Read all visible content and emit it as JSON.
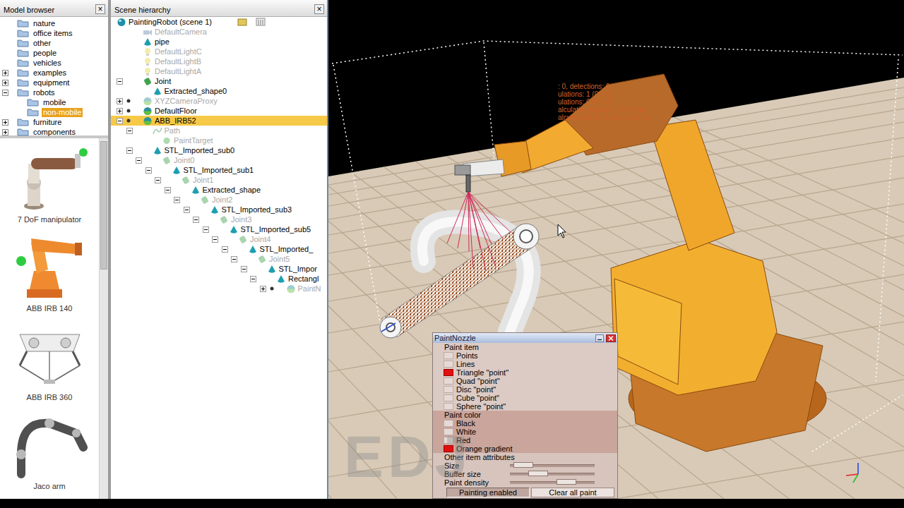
{
  "model_browser": {
    "title": "Model browser",
    "close": "×",
    "folders": [
      {
        "label": "nature",
        "depth": 0,
        "expandable": false,
        "expanded": false,
        "selected": false
      },
      {
        "label": "office items",
        "depth": 0,
        "expandable": false,
        "expanded": false,
        "selected": false
      },
      {
        "label": "other",
        "depth": 0,
        "expandable": false,
        "expanded": false,
        "selected": false
      },
      {
        "label": "people",
        "depth": 0,
        "expandable": false,
        "expanded": false,
        "selected": false
      },
      {
        "label": "vehicles",
        "depth": 0,
        "expandable": false,
        "expanded": false,
        "selected": false
      },
      {
        "label": "examples",
        "depth": 0,
        "expandable": true,
        "expanded": false,
        "selected": false
      },
      {
        "label": "equipment",
        "depth": 0,
        "expandable": true,
        "expanded": false,
        "selected": false
      },
      {
        "label": "robots",
        "depth": 0,
        "expandable": true,
        "expanded": true,
        "selected": false
      },
      {
        "label": "mobile",
        "depth": 1,
        "expandable": false,
        "expanded": false,
        "selected": false
      },
      {
        "label": "non-mobile",
        "depth": 1,
        "expandable": false,
        "expanded": false,
        "selected": true
      },
      {
        "label": "furniture",
        "depth": 0,
        "expandable": true,
        "expanded": false,
        "selected": false
      },
      {
        "label": "components",
        "depth": 0,
        "expandable": true,
        "expanded": false,
        "selected": false
      }
    ],
    "models": [
      {
        "label": "7 DoF manipulator",
        "kind": "manipulator"
      },
      {
        "label": "ABB IRB 140",
        "kind": "irb140"
      },
      {
        "label": "ABB IRB 360",
        "kind": "delta"
      },
      {
        "label": "Jaco arm",
        "kind": "jaco"
      }
    ]
  },
  "scene_hierarchy": {
    "title": "Scene hierarchy",
    "close": "×",
    "items": [
      {
        "label": "PaintingRobot (scene 1)",
        "depth": 0,
        "kind": "scene",
        "disabled": false,
        "expandable": false,
        "expanded": false,
        "model": false,
        "selected": false
      },
      {
        "label": "DefaultCamera",
        "depth": 1,
        "kind": "camera",
        "disabled": true,
        "expandable": false,
        "expanded": false,
        "model": false,
        "selected": false
      },
      {
        "label": "pipe",
        "depth": 1,
        "kind": "shape",
        "disabled": false,
        "expandable": false,
        "expanded": false,
        "model": false,
        "selected": false
      },
      {
        "label": "DefaultLightC",
        "depth": 1,
        "kind": "light",
        "disabled": true,
        "expandable": false,
        "expanded": false,
        "model": false,
        "selected": false
      },
      {
        "label": "DefaultLightB",
        "depth": 1,
        "kind": "light",
        "disabled": true,
        "expandable": false,
        "expanded": false,
        "model": false,
        "selected": false
      },
      {
        "label": "DefaultLightA",
        "depth": 1,
        "kind": "light",
        "disabled": true,
        "expandable": false,
        "expanded": false,
        "model": false,
        "selected": false
      },
      {
        "label": "Joint",
        "depth": 1,
        "kind": "joint",
        "disabled": false,
        "expandable": true,
        "expanded": true,
        "model": false,
        "selected": false
      },
      {
        "label": "Extracted_shape0",
        "depth": 2,
        "kind": "shape",
        "disabled": false,
        "expandable": false,
        "expanded": false,
        "model": false,
        "selected": false
      },
      {
        "label": "XYZCameraProxy",
        "depth": 1,
        "kind": "model",
        "disabled": true,
        "expandable": true,
        "expanded": false,
        "model": true,
        "selected": false
      },
      {
        "label": "DefaultFloor",
        "depth": 1,
        "kind": "model",
        "disabled": false,
        "expandable": true,
        "expanded": false,
        "model": true,
        "selected": false
      },
      {
        "label": "ABB_IRB52",
        "depth": 1,
        "kind": "model",
        "disabled": false,
        "expandable": true,
        "expanded": true,
        "model": true,
        "selected": true
      },
      {
        "label": "Path",
        "depth": 2,
        "kind": "path",
        "disabled": true,
        "expandable": true,
        "expanded": true,
        "model": false,
        "selected": false
      },
      {
        "label": "PaintTarget",
        "depth": 3,
        "kind": "dummy",
        "disabled": true,
        "expandable": false,
        "expanded": false,
        "model": false,
        "selected": false
      },
      {
        "label": "STL_Imported_sub0",
        "depth": 2,
        "kind": "shape",
        "disabled": false,
        "expandable": true,
        "expanded": true,
        "model": false,
        "selected": false
      },
      {
        "label": "Joint0",
        "depth": 3,
        "kind": "joint",
        "disabled": true,
        "expandable": true,
        "expanded": true,
        "model": false,
        "selected": false
      },
      {
        "label": "STL_Imported_sub1",
        "depth": 4,
        "kind": "shape",
        "disabled": false,
        "expandable": true,
        "expanded": true,
        "model": false,
        "selected": false
      },
      {
        "label": "Joint1",
        "depth": 5,
        "kind": "joint",
        "disabled": true,
        "expandable": true,
        "expanded": true,
        "model": false,
        "selected": false
      },
      {
        "label": "Extracted_shape",
        "depth": 6,
        "kind": "shape",
        "disabled": false,
        "expandable": true,
        "expanded": true,
        "model": false,
        "selected": false
      },
      {
        "label": "Joint2",
        "depth": 7,
        "kind": "joint",
        "disabled": true,
        "expandable": true,
        "expanded": true,
        "model": false,
        "selected": false
      },
      {
        "label": "STL_Imported_sub3",
        "depth": 8,
        "kind": "shape",
        "disabled": false,
        "expandable": true,
        "expanded": true,
        "model": false,
        "selected": false
      },
      {
        "label": "Joint3",
        "depth": 9,
        "kind": "joint",
        "disabled": true,
        "expandable": true,
        "expanded": true,
        "model": false,
        "selected": false
      },
      {
        "label": "STL_Imported_sub5",
        "depth": 10,
        "kind": "shape",
        "disabled": false,
        "expandable": true,
        "expanded": true,
        "model": false,
        "selected": false
      },
      {
        "label": "Joint4",
        "depth": 11,
        "kind": "joint",
        "disabled": true,
        "expandable": true,
        "expanded": true,
        "model": false,
        "selected": false
      },
      {
        "label": "STL_Imported_",
        "depth": 12,
        "kind": "shape",
        "disabled": false,
        "expandable": true,
        "expanded": true,
        "model": false,
        "selected": false
      },
      {
        "label": "Joint5",
        "depth": 13,
        "kind": "joint",
        "disabled": true,
        "expandable": true,
        "expanded": true,
        "model": false,
        "selected": false
      },
      {
        "label": "STL_Impor",
        "depth": 14,
        "kind": "shape",
        "disabled": false,
        "expandable": true,
        "expanded": true,
        "model": false,
        "selected": false
      },
      {
        "label": "Rectangl",
        "depth": 15,
        "kind": "shape",
        "disabled": false,
        "expandable": true,
        "expanded": true,
        "model": false,
        "selected": false
      },
      {
        "label": "PaintN",
        "depth": 16,
        "kind": "model",
        "disabled": true,
        "expandable": true,
        "expanded": false,
        "model": true,
        "selected": false
      }
    ]
  },
  "viewport": {
    "info_lines": [
      ": 0, detections: 0",
      "ulations: 1 (0 ms)",
      "ulations: 0 (0 ms)",
      "alculation passes: 0 (no dyn",
      "alculations: 0, surface cut: 0 r"
    ],
    "watermark": "EDJ"
  },
  "dialog": {
    "title": "PaintNozzle",
    "sections": [
      {
        "label": "Paint item",
        "kind": "options",
        "options": [
          {
            "label": "Points",
            "selected": false
          },
          {
            "label": "Lines",
            "selected": false
          },
          {
            "label": "Triangle \"point\"",
            "selected": true
          },
          {
            "label": "Quad \"point\"",
            "selected": false
          },
          {
            "label": "Disc \"point\"",
            "selected": false
          },
          {
            "label": "Cube \"point\"",
            "selected": false
          },
          {
            "label": "Sphere \"point\"",
            "selected": false
          }
        ]
      },
      {
        "label": "Paint color",
        "kind": "options",
        "options": [
          {
            "label": "Black",
            "selected": false
          },
          {
            "label": "White",
            "selected": false
          },
          {
            "label": "Red",
            "selected": false
          },
          {
            "label": "Orange gradient",
            "selected": true
          }
        ]
      },
      {
        "label": "Other item attributes",
        "kind": "sliders",
        "sliders": [
          {
            "label": "Size",
            "level": 0.05
          },
          {
            "label": "Buffer size",
            "level": 0.28
          },
          {
            "label": "Paint density",
            "level": 0.72
          }
        ]
      }
    ],
    "buttons": [
      {
        "label": "Painting enabled",
        "pressed": true
      },
      {
        "label": "Clear all paint",
        "pressed": false
      }
    ]
  }
}
